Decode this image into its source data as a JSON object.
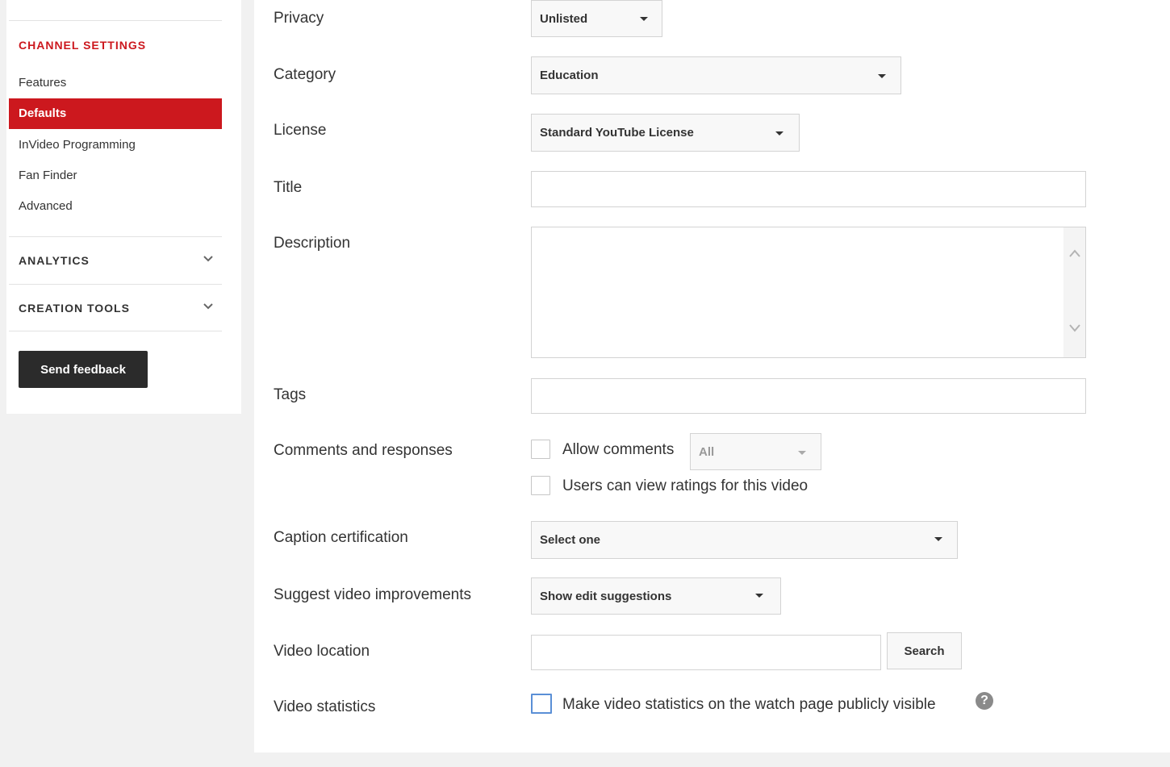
{
  "sidebar": {
    "channel_settings_title": "CHANNEL SETTINGS",
    "items": [
      {
        "label": "Features",
        "active": false
      },
      {
        "label": "Defaults",
        "active": true
      },
      {
        "label": "InVideo Programming",
        "active": false
      },
      {
        "label": "Fan Finder",
        "active": false
      },
      {
        "label": "Advanced",
        "active": false
      }
    ],
    "analytics_label": "ANALYTICS",
    "creation_tools_label": "CREATION TOOLS",
    "feedback_label": "Send feedback"
  },
  "form": {
    "privacy": {
      "label": "Privacy",
      "value": "Unlisted"
    },
    "category": {
      "label": "Category",
      "value": "Education"
    },
    "license": {
      "label": "License",
      "value": "Standard YouTube License"
    },
    "title": {
      "label": "Title",
      "value": ""
    },
    "description": {
      "label": "Description",
      "value": ""
    },
    "tags": {
      "label": "Tags",
      "value": ""
    },
    "comments": {
      "label": "Comments and responses",
      "allow_comments": "Allow comments",
      "allow_comments_checked": false,
      "comments_filter": "All",
      "ratings": "Users can view ratings for this video",
      "ratings_checked": false
    },
    "caption": {
      "label": "Caption certification",
      "value": "Select one"
    },
    "suggest": {
      "label": "Suggest video improvements",
      "value": "Show edit suggestions"
    },
    "location": {
      "label": "Video location",
      "value": "",
      "search_label": "Search"
    },
    "statistics": {
      "label": "Video statistics",
      "option": "Make video statistics on the watch page publicly visible",
      "checked": false,
      "help_glyph": "?"
    }
  },
  "colors": {
    "accent": "#cc181e",
    "dark_button": "#2b2b2b",
    "checkbox_focus": "#5a8fd6"
  }
}
